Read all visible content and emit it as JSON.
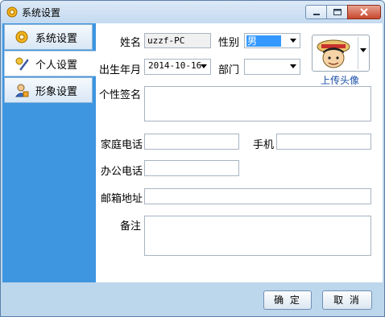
{
  "window": {
    "title": "系统设置"
  },
  "sidebar": {
    "items": [
      {
        "label": "系统设置",
        "icon": "gear-icon"
      },
      {
        "label": "个人设置",
        "icon": "pen-icon"
      },
      {
        "label": "形象设置",
        "icon": "user-icon"
      }
    ],
    "active": 1
  },
  "form": {
    "name_label": "姓名",
    "name_value": "uzzf-PC",
    "gender_label": "性别",
    "gender_value": "男",
    "birth_label": "出生年月",
    "birth_value": "2014-10-16",
    "dept_label": "部门",
    "dept_value": "",
    "sig_label": "个性签名",
    "sig_value": "",
    "home_phone_label": "家庭电话",
    "home_phone_value": "",
    "mobile_label": "手机",
    "mobile_value": "",
    "office_phone_label": "办公电话",
    "office_phone_value": "",
    "email_label": "邮箱地址",
    "email_value": "",
    "note_label": "备注",
    "note_value": ""
  },
  "avatar": {
    "upload_label": "上传头像"
  },
  "footer": {
    "ok_label": "确 定",
    "cancel_label": "取 消"
  }
}
